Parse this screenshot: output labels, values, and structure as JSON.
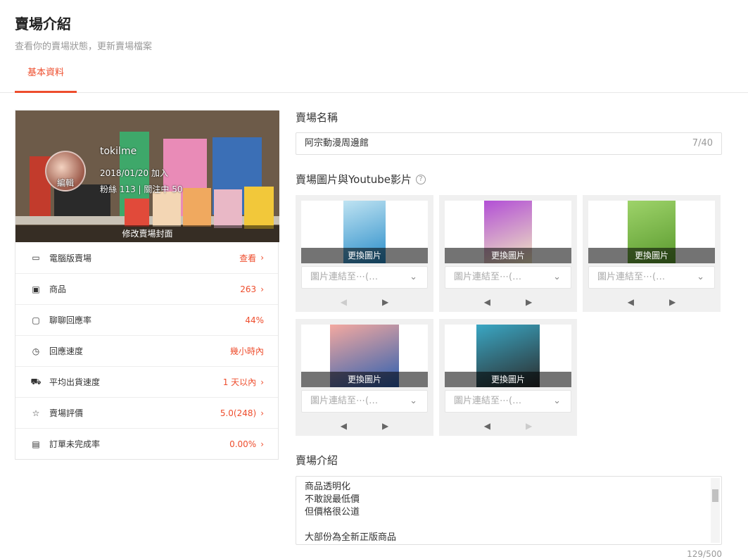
{
  "header": {
    "title": "賣場介紹",
    "subtitle": "查看你的賣場狀態，更新賣場檔案"
  },
  "tabs": [
    {
      "label": "基本資料"
    }
  ],
  "shop": {
    "username": "tokilme",
    "joined": "2018/01/20 加入",
    "follow": "粉絲 113 | 關注中 50",
    "avatar_edit": "編輯",
    "cover_edit": "修改賣場封面"
  },
  "stats": [
    {
      "icon": "desktop-icon",
      "label": "電腦版賣場",
      "value": "查看",
      "chevron": true
    },
    {
      "icon": "gift-icon",
      "label": "商品",
      "value": "263",
      "chevron": true
    },
    {
      "icon": "chat-icon",
      "label": "聊聊回應率",
      "value": "44%",
      "chevron": false
    },
    {
      "icon": "clock-icon",
      "label": "回應速度",
      "value": "幾小時內",
      "chevron": false
    },
    {
      "icon": "truck-icon",
      "label": "平均出貨速度",
      "value": "1 天以內",
      "chevron": true
    },
    {
      "icon": "star-icon",
      "label": "賣場評價",
      "value": "5.0(248)",
      "chevron": true
    },
    {
      "icon": "clipboard-icon",
      "label": "訂單未完成率",
      "value": "0.00%",
      "chevron": true
    }
  ],
  "form": {
    "name_label": "賣場名稱",
    "name_value": "阿宗動漫周邊館",
    "name_count": "7/40",
    "images_label": "賣場圖片與Youtube影片",
    "change_image": "更換圖片",
    "link_placeholder": "圖片連結至⋯(…",
    "intro_label": "賣場介紹",
    "intro_lines": [
      "商品透明化",
      "不敢說最低價",
      "但價格很公道",
      "",
      "大部份為全新正版商品"
    ],
    "intro_count": "129/500"
  },
  "images": [
    {
      "thumb_color": "#bfe3f2",
      "accent": "#2a8dc9"
    },
    {
      "thumb_color": "#b24fd6",
      "accent": "#f0e6c0"
    },
    {
      "thumb_color": "#9ed36a",
      "accent": "#5a9a2e"
    },
    {
      "thumb_color": "#f4a9a0",
      "accent": "#2c5fb0"
    },
    {
      "thumb_color": "#3aa7c4",
      "accent": "#2b2b2b"
    }
  ],
  "colors": {
    "accent": "#ee4d2d"
  }
}
